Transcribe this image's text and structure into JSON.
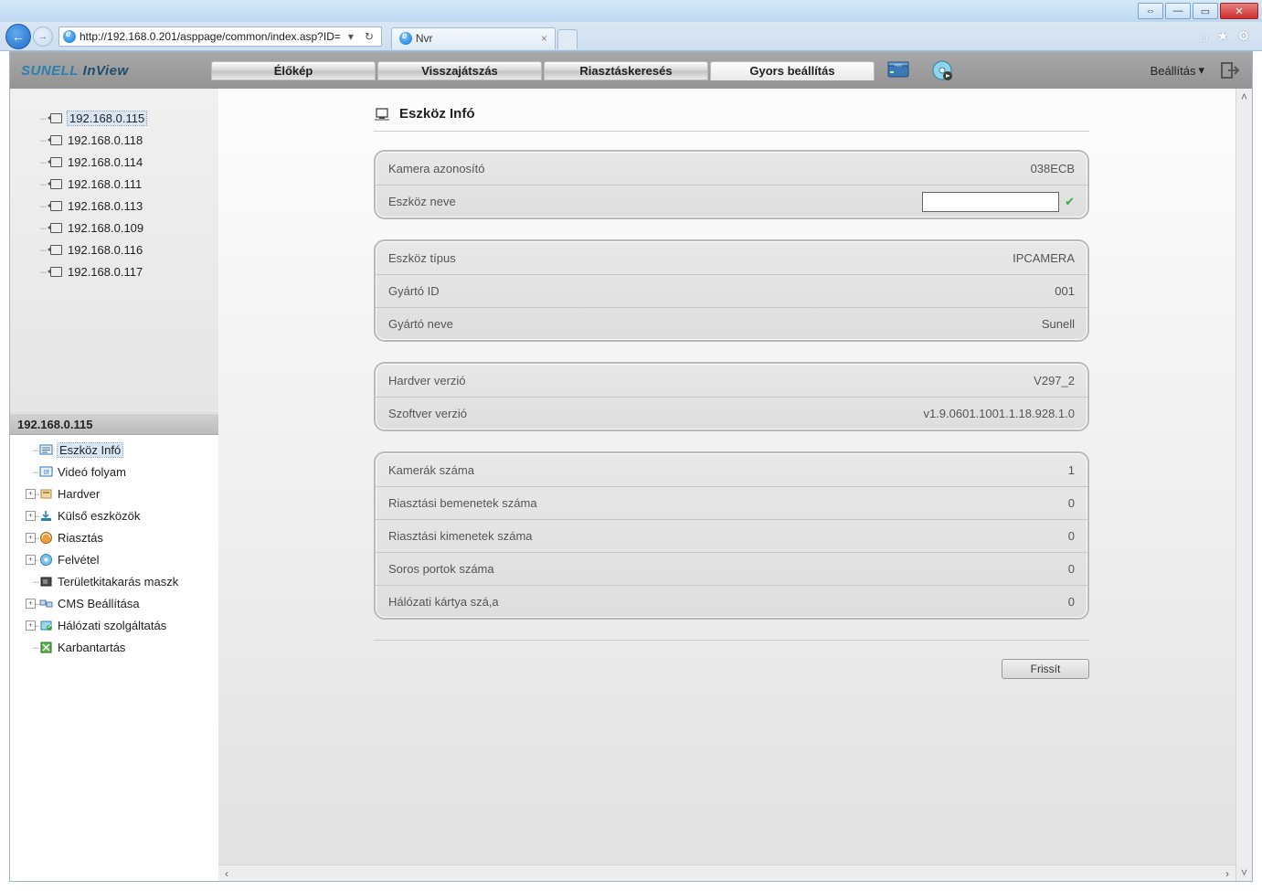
{
  "browser": {
    "url": "http://192.168.0.201/asppage/common/index.asp?ID=",
    "tab_title": "Nvr"
  },
  "header": {
    "brand": "SUNELL InView",
    "tabs": {
      "live": "Élőkép",
      "playback": "Visszajátszás",
      "alarm_search": "Riasztáskeresés",
      "quick_setup": "Gyors beállítás"
    },
    "settings_label": "Beállítás"
  },
  "device_tree": {
    "items": [
      "192.168.0.115",
      "192.168.0.118",
      "192.168.0.114",
      "192.168.0.111",
      "192.168.0.113",
      "192.168.0.109",
      "192.168.0.116",
      "192.168.0.117"
    ]
  },
  "section_header": "192.168.0.115",
  "config_tree": [
    {
      "label": "Eszköz Infó",
      "expandable": false,
      "selected": true
    },
    {
      "label": "Videó folyam",
      "expandable": false
    },
    {
      "label": "Hardver",
      "expandable": true
    },
    {
      "label": "Külső eszközök",
      "expandable": true
    },
    {
      "label": "Riasztás",
      "expandable": true
    },
    {
      "label": "Felvétel",
      "expandable": true
    },
    {
      "label": "Területkitakarás maszk",
      "expandable": false
    },
    {
      "label": "CMS Beállítása",
      "expandable": true
    },
    {
      "label": "Hálózati szolgáltatás",
      "expandable": true
    },
    {
      "label": "Karbantartás",
      "expandable": false
    }
  ],
  "page": {
    "title": "Eszköz Infó",
    "camera_id_label": "Kamera azonosító",
    "camera_id_value": "038ECB",
    "device_name_label": "Eszköz neve",
    "device_name_value": "",
    "device_type_label": "Eszköz típus",
    "device_type_value": "IPCAMERA",
    "vendor_id_label": "Gyártó ID",
    "vendor_id_value": "001",
    "vendor_name_label": "Gyártó neve",
    "vendor_name_value": "Sunell",
    "hw_ver_label": "Hardver verzió",
    "hw_ver_value": "V297_2",
    "sw_ver_label": "Szoftver verzió",
    "sw_ver_value": "v1.9.0601.1001.1.18.928.1.0",
    "cam_count_label": "Kamerák száma",
    "cam_count_value": "1",
    "alarm_in_label": "Riasztási bemenetek száma",
    "alarm_in_value": "0",
    "alarm_out_label": "Riasztási kimenetek száma",
    "alarm_out_value": "0",
    "serial_label": "Soros portok száma",
    "serial_value": "0",
    "nic_label": "Hálózati kártya szá,a",
    "nic_value": "0",
    "refresh_btn": "Frissít"
  }
}
